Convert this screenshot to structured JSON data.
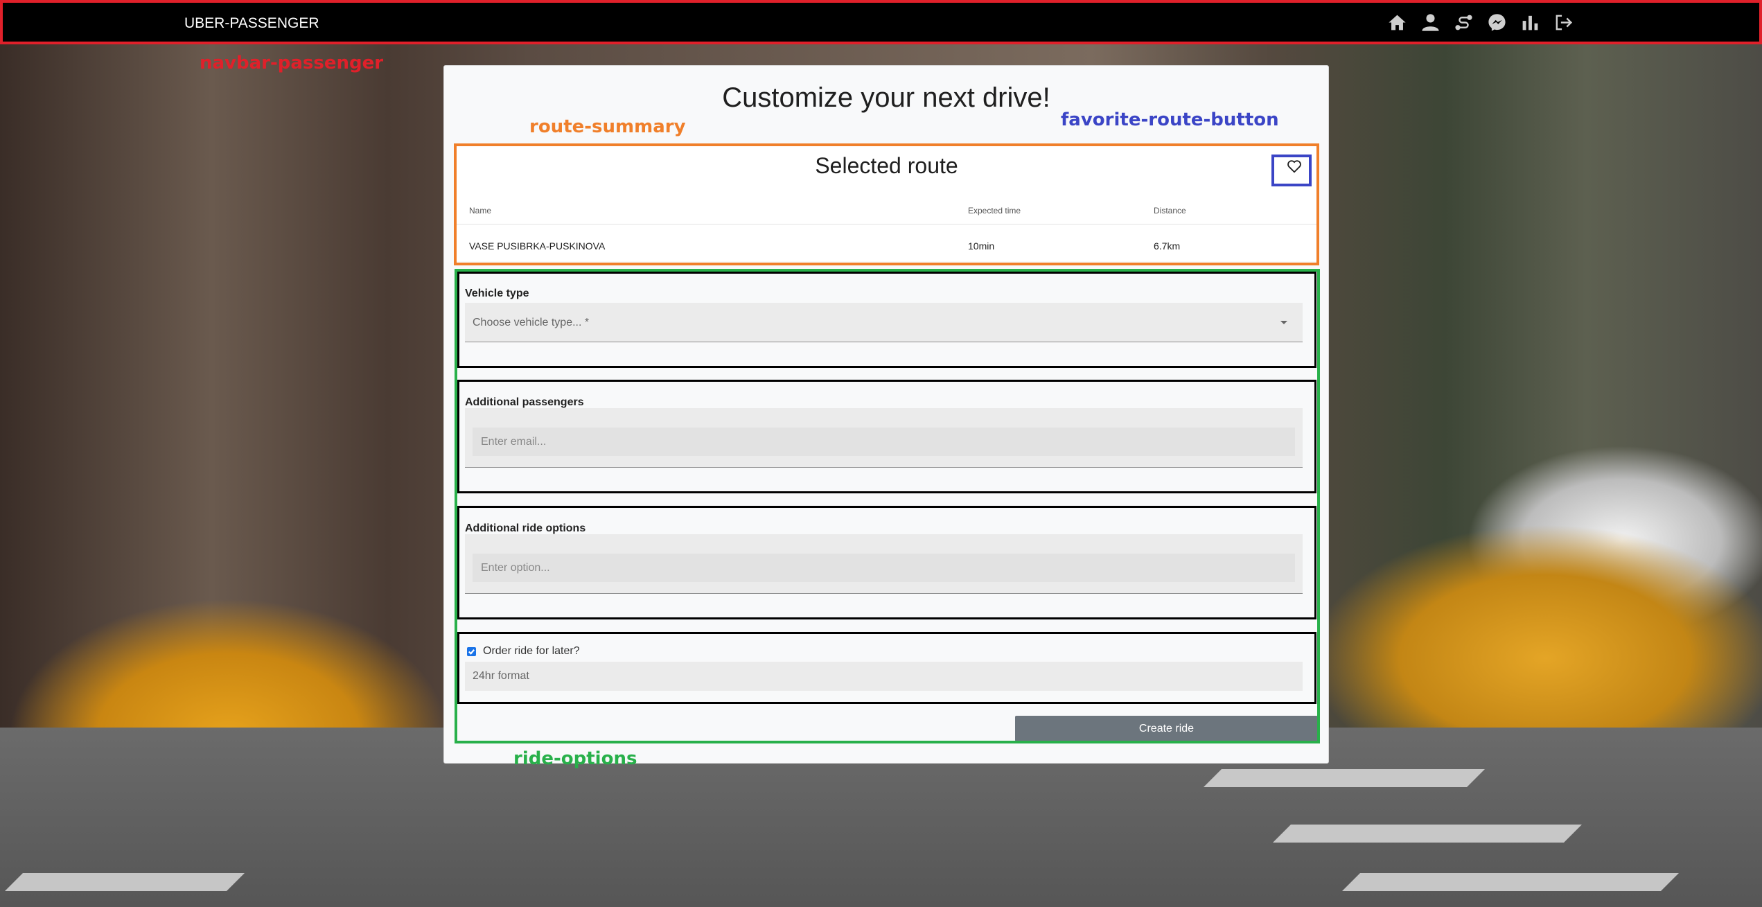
{
  "navbar": {
    "brand": "UBER-PASSENGER",
    "icons": [
      "home-icon",
      "user-icon",
      "route-icon",
      "messenger-icon",
      "chart-icon",
      "logout-icon"
    ]
  },
  "annotations": {
    "navbar": "navbar-passenger",
    "route_summary": "route-summary",
    "favorite_route_button": "favorite-route-button",
    "ride_options": "ride-options"
  },
  "card": {
    "title": "Customize your next drive!"
  },
  "route": {
    "title": "Selected route",
    "columns": [
      "Name",
      "Expected time",
      "Distance"
    ],
    "row": [
      "VASE PUSIBRKA-PUSKINOVA",
      "10min",
      "6.7km"
    ]
  },
  "vehicle": {
    "label": "Vehicle type",
    "placeholder": "Choose vehicle type... *"
  },
  "passengers": {
    "label": "Additional passengers",
    "placeholder": "Enter email..."
  },
  "options": {
    "label": "Additional ride options",
    "placeholder": "Enter option..."
  },
  "schedule": {
    "checkbox_label": "Order ride for later?",
    "checked": true,
    "placeholder": "24hr format"
  },
  "create_button": "Create ride",
  "colors": {
    "navbar_border": "#e0202a",
    "route_summary_border": "#f07f2a",
    "favorite_border": "#3b45c6",
    "ride_options_border": "#28b04a",
    "checkbox": "#1a73e8",
    "button": "#6c757d"
  }
}
